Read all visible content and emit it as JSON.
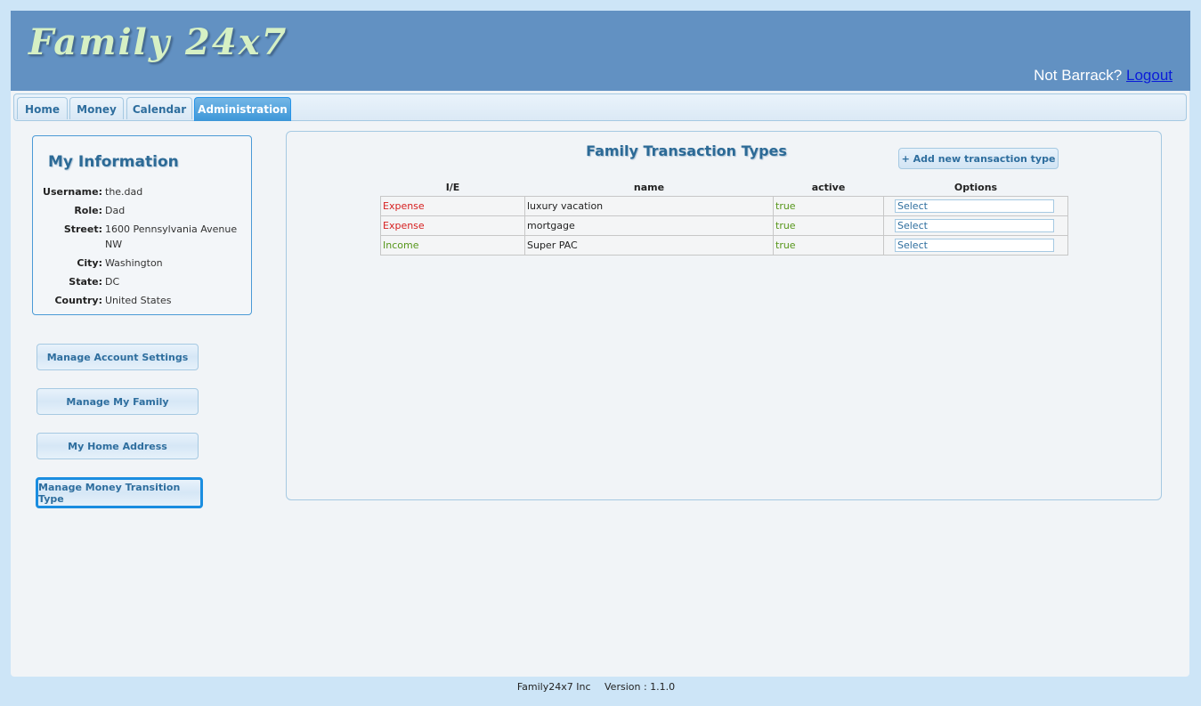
{
  "header": {
    "logo": "Family 24x7",
    "not_user": "Not Barrack?",
    "logout": "Logout"
  },
  "tabs": [
    {
      "label": "Home"
    },
    {
      "label": "Money"
    },
    {
      "label": "Calendar"
    },
    {
      "label": "Administration",
      "active": true
    }
  ],
  "info": {
    "title": "My Information",
    "rows": [
      {
        "label": "Username:",
        "value": "the.dad"
      },
      {
        "label": "Role:",
        "value": "Dad"
      },
      {
        "label": "Street:",
        "value": "1600 Pennsylvania Avenue NW"
      },
      {
        "label": "City:",
        "value": "Washington"
      },
      {
        "label": "State:",
        "value": "DC"
      },
      {
        "label": "Country:",
        "value": "United States"
      }
    ]
  },
  "sidebar": {
    "buttons": [
      {
        "label": "Manage Account Settings"
      },
      {
        "label": "Manage My Family"
      },
      {
        "label": "My Home Address"
      },
      {
        "label": "Manage Money Transition Type"
      }
    ]
  },
  "main": {
    "title": "Family Transaction Types",
    "add_button": "+ Add new transaction type",
    "columns": [
      "I/E",
      "name",
      "active",
      "Options"
    ],
    "rows": [
      {
        "ie": "Expense",
        "name": "luxury vacation",
        "active": "true",
        "option": "Select"
      },
      {
        "ie": "Expense",
        "name": "mortgage",
        "active": "true",
        "option": "Select"
      },
      {
        "ie": "Income",
        "name": "Super PAC",
        "active": "true",
        "option": "Select"
      }
    ]
  },
  "footer": {
    "company": "Family24x7 Inc",
    "version": "Version : 1.1.0"
  },
  "colors": {
    "header_bg": "#6291c2",
    "page_bg": "#cde5f7",
    "expense": "#d61f1f",
    "income": "#56961a",
    "accent": "#2e6e9e"
  }
}
